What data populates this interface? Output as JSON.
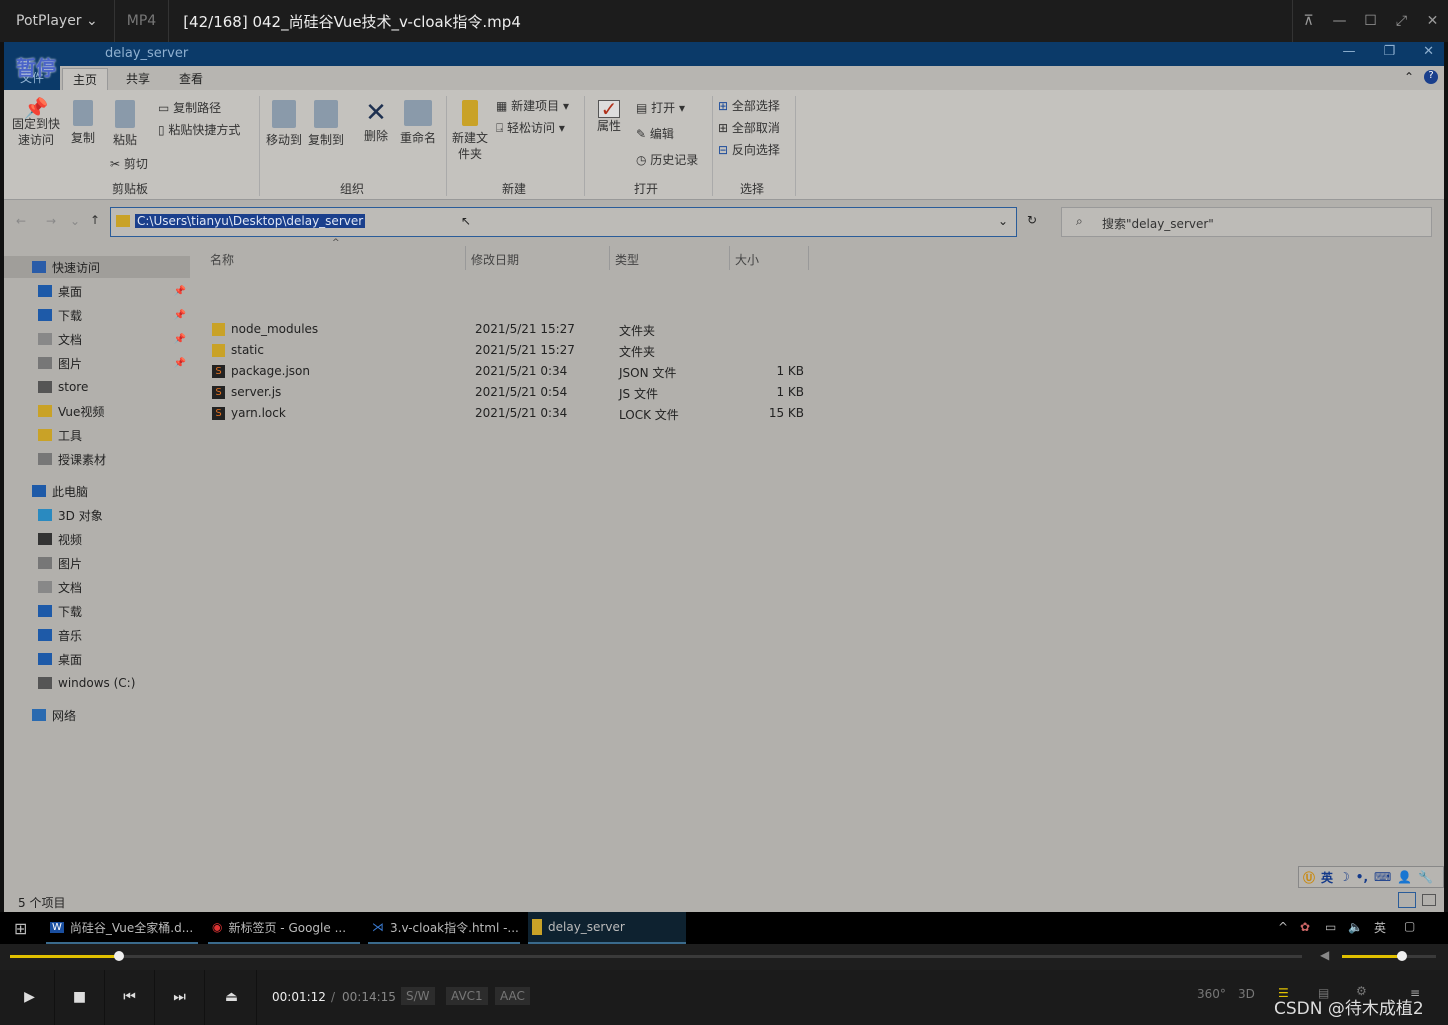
{
  "player": {
    "brand": "PotPlayer",
    "format": "MP4",
    "file": "[42/168] 042_尚硅谷Vue技术_v-cloak指令.mp4",
    "overlay": "暂停",
    "current_time": "00:01:12",
    "total_time": "00:14:15",
    "tags": [
      "S/W",
      "AVC1",
      "AAC"
    ],
    "progress": 0.084,
    "volume": 0.72,
    "watermark": "CSDN @待木成植2",
    "right_icons": [
      "360°",
      "3D"
    ]
  },
  "explorer": {
    "title": "delay_server",
    "tabs": [
      "文件",
      "主页",
      "共享",
      "查看"
    ],
    "ribbon": {
      "pin": "固定到快速访问",
      "copy": "复制",
      "paste": "粘贴",
      "copy_path": "复制路径",
      "paste_shortcut": "粘贴快捷方式",
      "cut": "剪切",
      "move_to": "移动到",
      "copy_to": "复制到",
      "delete": "删除",
      "rename": "重命名",
      "new_folder": "新建文件夹",
      "new_item": "新建项目",
      "easy_access": "轻松访问",
      "properties": "属性",
      "open": "打开",
      "edit": "编辑",
      "history": "历史记录",
      "select_all": "全部选择",
      "select_none": "全部取消",
      "invert": "反向选择",
      "groups": [
        "剪贴板",
        "组织",
        "新建",
        "打开",
        "选择"
      ]
    },
    "address": "C:\\Users\\tianyu\\Desktop\\delay_server",
    "search_placeholder": "搜索\"delay_server\"",
    "nav": [
      {
        "label": "快速访问",
        "icon": "star-icon"
      },
      {
        "label": "桌面",
        "icon": "desktop-icon",
        "pinned": true
      },
      {
        "label": "下载",
        "icon": "download-icon",
        "pinned": true
      },
      {
        "label": "文档",
        "icon": "document-icon",
        "pinned": true
      },
      {
        "label": "图片",
        "icon": "picture-icon",
        "pinned": true
      },
      {
        "label": "store",
        "icon": "drive-icon"
      },
      {
        "label": "Vue视频",
        "icon": "folder-icon"
      },
      {
        "label": "工具",
        "icon": "folder-icon"
      },
      {
        "label": "授课素材",
        "icon": "disc-icon"
      },
      {
        "label": "此电脑",
        "icon": "computer-icon"
      },
      {
        "label": "3D 对象",
        "icon": "cube-icon"
      },
      {
        "label": "视频",
        "icon": "video-icon"
      },
      {
        "label": "图片",
        "icon": "picture-icon"
      },
      {
        "label": "文档",
        "icon": "document-icon"
      },
      {
        "label": "下载",
        "icon": "download-icon"
      },
      {
        "label": "音乐",
        "icon": "music-icon"
      },
      {
        "label": "桌面",
        "icon": "desktop-icon"
      },
      {
        "label": "windows (C:)",
        "icon": "drive-icon"
      },
      {
        "label": "网络",
        "icon": "network-icon"
      }
    ],
    "columns": [
      "名称",
      "修改日期",
      "类型",
      "大小"
    ],
    "files": [
      {
        "name": "node_modules",
        "date": "2021/5/21 15:27",
        "type": "文件夹",
        "size": "",
        "icon": "folder-icon"
      },
      {
        "name": "static",
        "date": "2021/5/21 15:27",
        "type": "文件夹",
        "size": "",
        "icon": "folder-icon"
      },
      {
        "name": "package.json",
        "date": "2021/5/21 0:34",
        "type": "JSON 文件",
        "size": "1 KB",
        "icon": "sublime-icon"
      },
      {
        "name": "server.js",
        "date": "2021/5/21 0:54",
        "type": "JS 文件",
        "size": "1 KB",
        "icon": "sublime-icon"
      },
      {
        "name": "yarn.lock",
        "date": "2021/5/21 0:34",
        "type": "LOCK 文件",
        "size": "15 KB",
        "icon": "sublime-icon"
      }
    ],
    "status": "5 个项目"
  },
  "ime": {
    "lang": "英"
  },
  "taskbar": {
    "items": [
      "尚硅谷_Vue全家桶.d...",
      "新标签页 - Google ...",
      "3.v-cloak指令.html -...",
      "delay_server"
    ],
    "tray_lang": "英"
  }
}
